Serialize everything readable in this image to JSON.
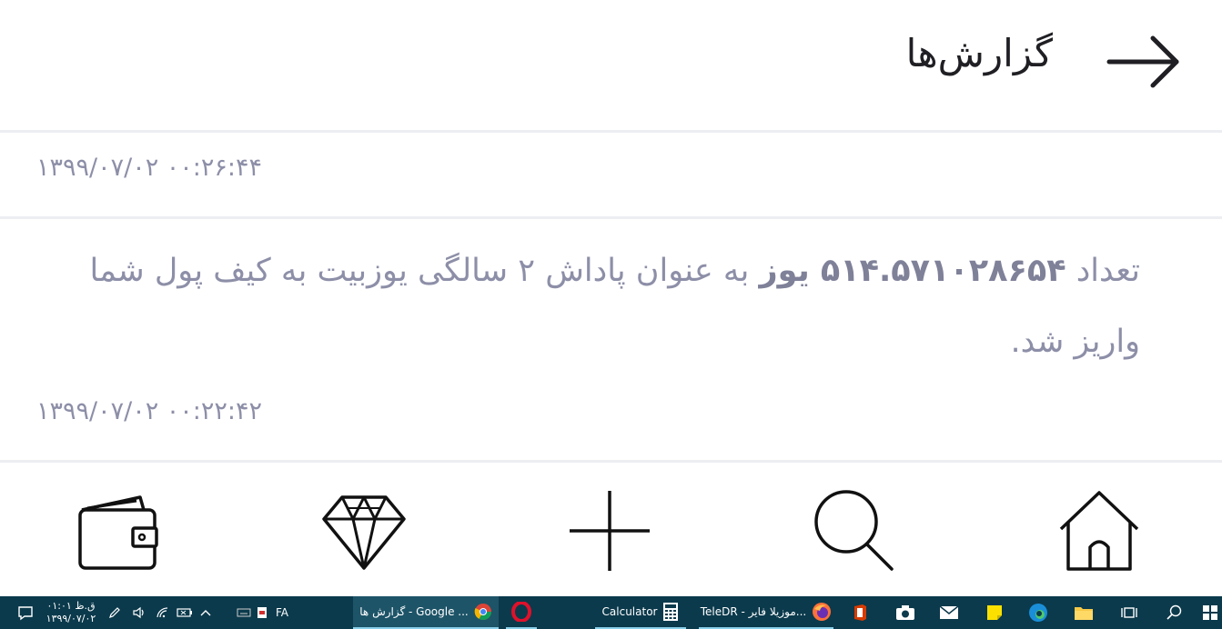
{
  "header": {
    "title": "گزارش‌ها",
    "back_icon": "arrow-right-icon"
  },
  "reports": [
    {
      "timestamp": "۱۳۹۹/۰۷/۰۲ ۰۰:۲۶:۴۴"
    },
    {
      "message_before": "تعداد ",
      "amount": "۵۱۴.۵۷۱۰۲۸۶۵۴",
      "unit": " یوز",
      "message_after": " به عنوان پاداش ۲ سالگی یوزبیت به کیف پول شما واریز شد.",
      "timestamp": "۱۳۹۹/۰۷/۰۲ ۰۰:۲۲:۴۲"
    }
  ],
  "bottom_nav": {
    "items": [
      {
        "name": "wallet",
        "icon": "wallet-icon"
      },
      {
        "name": "diamond",
        "icon": "diamond-icon"
      },
      {
        "name": "add",
        "icon": "plus-icon"
      },
      {
        "name": "search",
        "icon": "search-icon"
      },
      {
        "name": "home",
        "icon": "home-icon"
      }
    ]
  },
  "taskbar": {
    "clock_time": "۰۱:۰۱ ق.ظ",
    "clock_date": "۱۳۹۹/۰۷/۰۲",
    "language": "FA",
    "apps": [
      {
        "label": "گزارش ها - Google ...",
        "icon": "chrome-icon"
      },
      {
        "label": "",
        "icon": "opera-icon"
      },
      {
        "label": "Calculator",
        "icon": "calculator-icon"
      },
      {
        "label": "TeleDR - موزیلا فایر...",
        "icon": "firefox-icon"
      }
    ]
  },
  "colors": {
    "muted_text": "#8d8fa8",
    "divider": "#eceef2",
    "taskbar_bg": "#0b3a4c",
    "taskbar_active": "#1d5468"
  }
}
